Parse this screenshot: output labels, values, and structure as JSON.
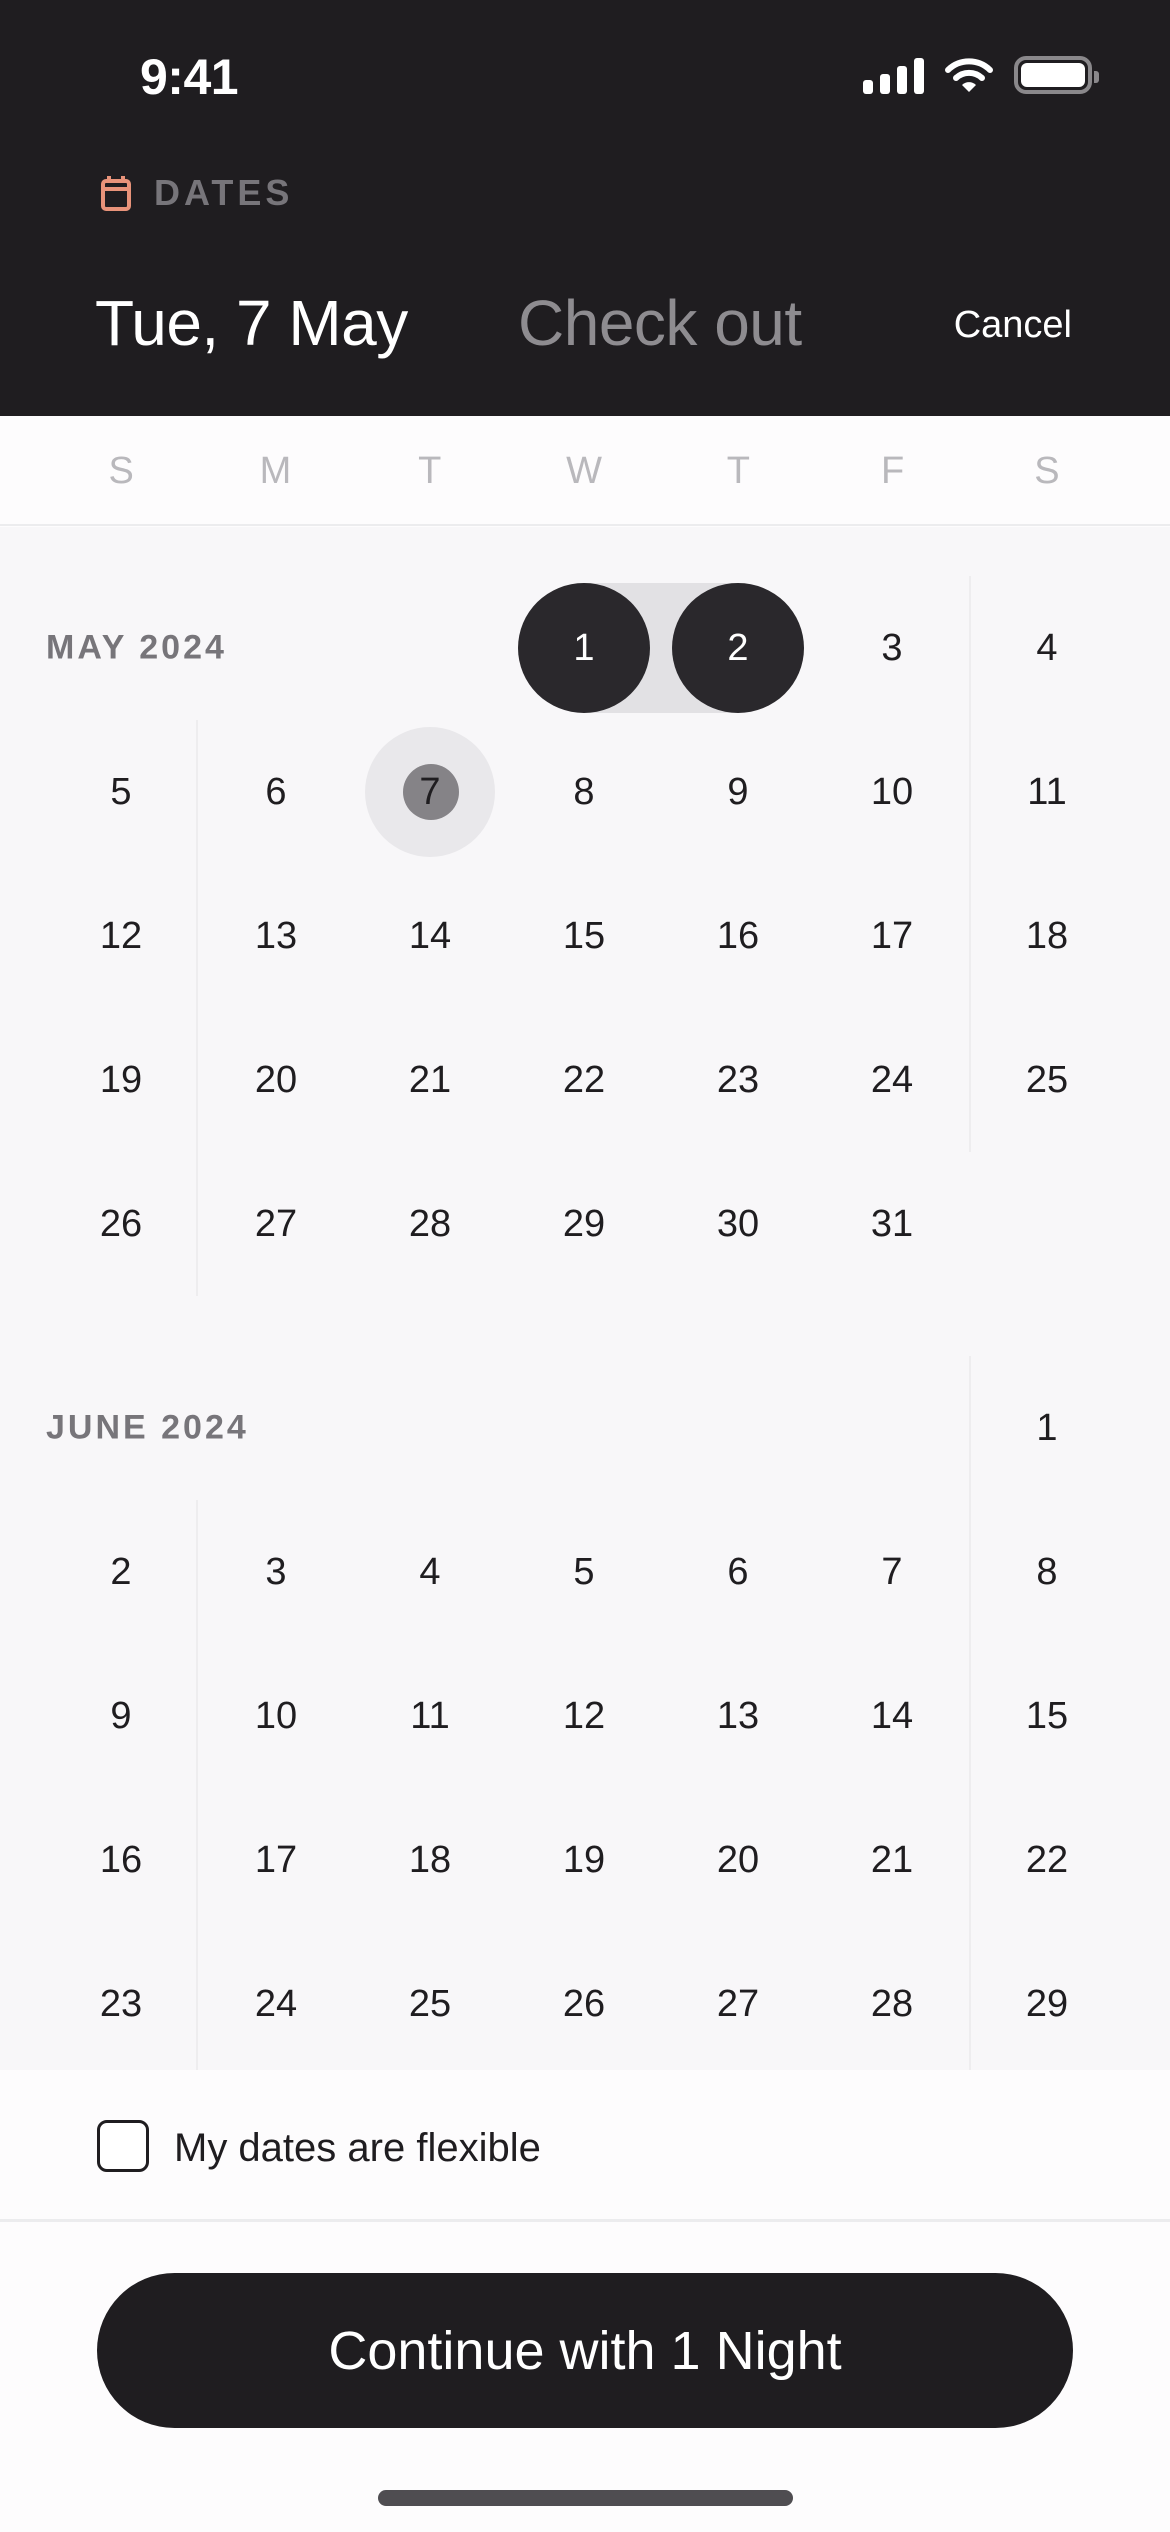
{
  "status_bar": {
    "time": "9:41",
    "icons": [
      "cellular-signal-icon",
      "wifi-icon",
      "battery-icon"
    ]
  },
  "header": {
    "section_label": "DATES",
    "section_icon": "calendar-icon",
    "check_in": "Tue, 7 May",
    "check_out_placeholder": "Check out",
    "cancel_label": "Cancel",
    "accent_color": "#e8937a"
  },
  "weekdays": [
    "S",
    "M",
    "T",
    "W",
    "T",
    "F",
    "S"
  ],
  "months": [
    {
      "title": "MAY 2024",
      "first_weekday": 3,
      "days": 31,
      "selected": [
        1,
        2
      ],
      "pressed": 7
    },
    {
      "title": "JUNE 2024",
      "first_weekday": 6,
      "days_visible": 29,
      "selected": [],
      "pressed": null
    }
  ],
  "footer": {
    "flexible_label": "My dates are flexible",
    "flexible_checked": false,
    "continue_label": "Continue with 1 Night"
  }
}
